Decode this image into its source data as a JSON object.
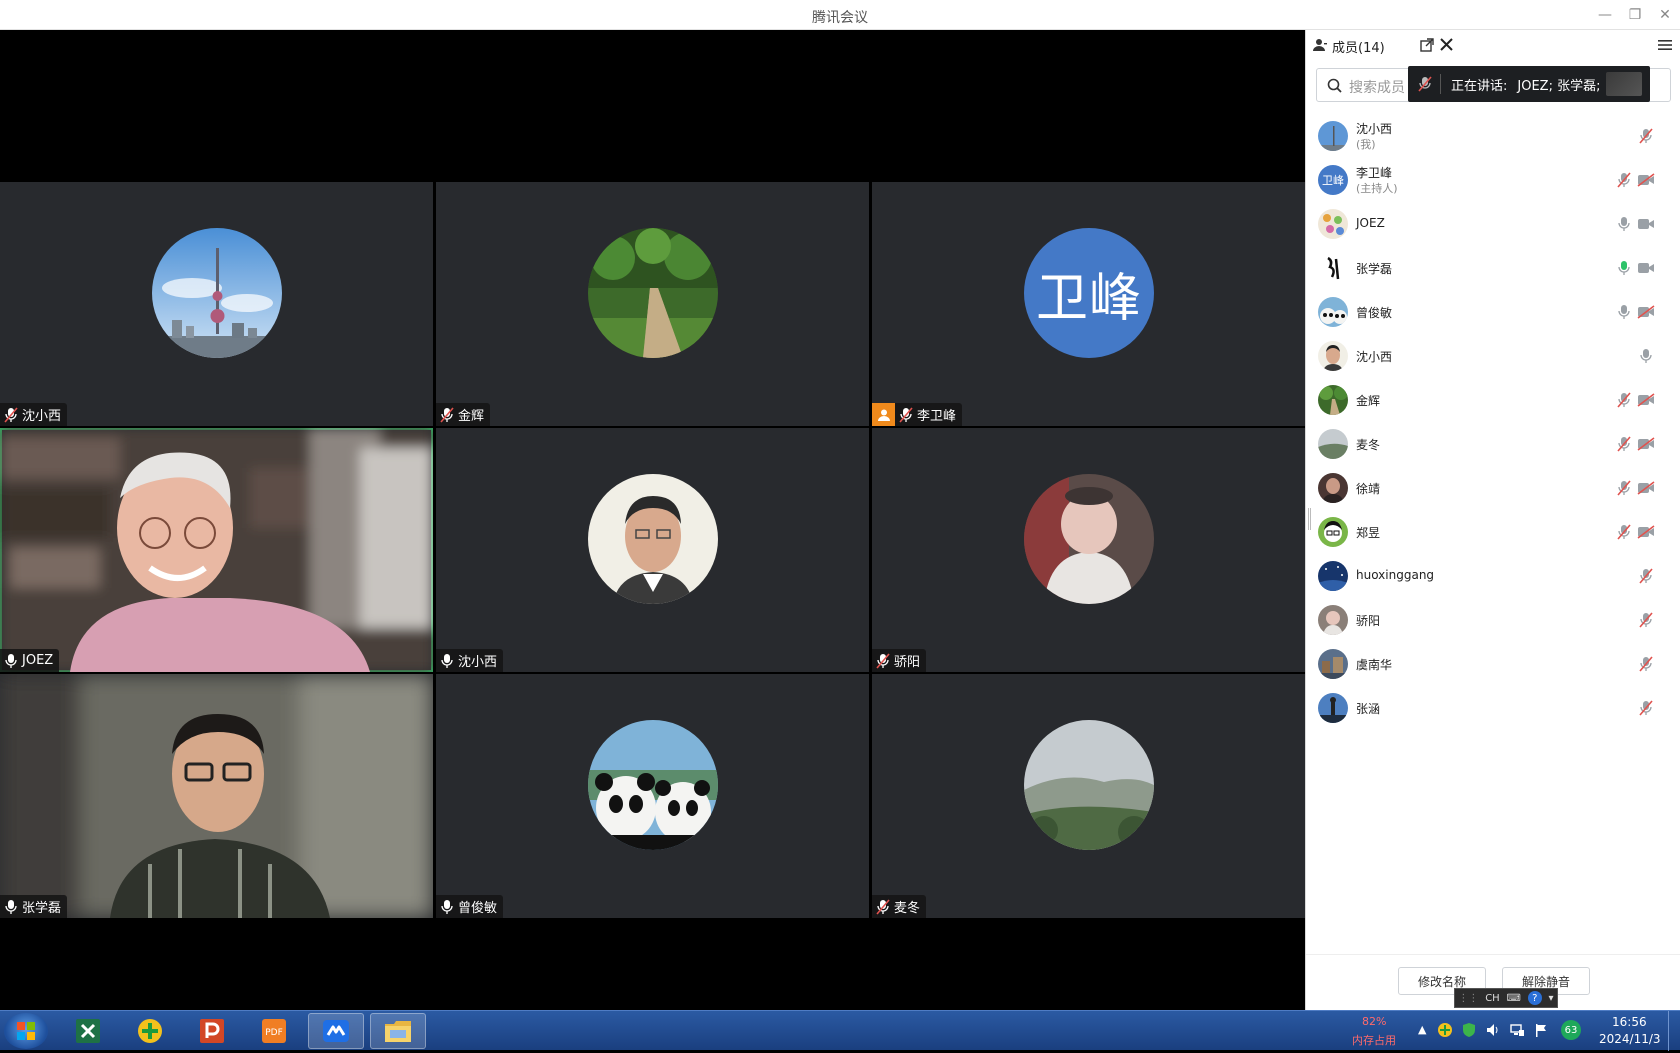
{
  "window": {
    "title": "腾讯会议"
  },
  "tiles": [
    {
      "name": "沈小西",
      "mic": "muted"
    },
    {
      "name": "金辉",
      "mic": "muted"
    },
    {
      "name": "李卫峰",
      "mic": "muted",
      "avatar_text": "卫峰",
      "host": true
    },
    {
      "name": "JOEZ",
      "mic": "on",
      "active": true
    },
    {
      "name": "沈小西",
      "mic": "on"
    },
    {
      "name": "骄阳",
      "mic": "muted"
    },
    {
      "name": "张学磊",
      "mic": "on"
    },
    {
      "name": "曾俊敏",
      "mic": "on"
    },
    {
      "name": "麦冬",
      "mic": "muted"
    }
  ],
  "panel": {
    "title": "成员(14)",
    "search_placeholder": "搜索成员",
    "speaking_label": "正在讲话:",
    "speaking_names": "JOEZ; 张学磊;",
    "members": [
      {
        "name": "沈小西",
        "sub": "(我)",
        "mic": "muted",
        "cam": "none"
      },
      {
        "name": "李卫峰",
        "sub": "(主持人)",
        "mic": "muted",
        "cam": "off",
        "avatar_text": "卫峰"
      },
      {
        "name": "JOEZ",
        "mic": "on",
        "cam": "on"
      },
      {
        "name": "张学磊",
        "mic": "speaking",
        "cam": "on"
      },
      {
        "name": "曾俊敏",
        "mic": "on",
        "cam": "off"
      },
      {
        "name": "沈小西",
        "mic": "on",
        "cam": "none"
      },
      {
        "name": "金辉",
        "mic": "muted",
        "cam": "off"
      },
      {
        "name": "麦冬",
        "mic": "muted",
        "cam": "off"
      },
      {
        "name": "徐靖",
        "mic": "muted",
        "cam": "off"
      },
      {
        "name": "郑昱",
        "mic": "muted",
        "cam": "off"
      },
      {
        "name": "huoxinggang",
        "mic": "muted",
        "cam": "none"
      },
      {
        "name": "骄阳",
        "mic": "muted",
        "cam": "none"
      },
      {
        "name": "虞南华",
        "mic": "muted",
        "cam": "none"
      },
      {
        "name": "张涵",
        "mic": "muted",
        "cam": "none"
      }
    ],
    "rename_button": "修改名称",
    "unmute_button": "解除静音"
  },
  "taskbar": {
    "apps": [
      "start-orb",
      "excel",
      "360-guard",
      "powerpoint",
      "pdf-reader",
      "tencent-meeting",
      "file-explorer"
    ],
    "memory_percent": "82%",
    "memory_label": "内存占用",
    "ime_label": "CH",
    "tray_badge": "63",
    "time": "16:56",
    "date": "2024/11/3"
  },
  "colors": {
    "accent": "#2ec36a",
    "host": "#f08a1c",
    "muted": "#e0534f",
    "avatar_blue": "#4479c7"
  }
}
